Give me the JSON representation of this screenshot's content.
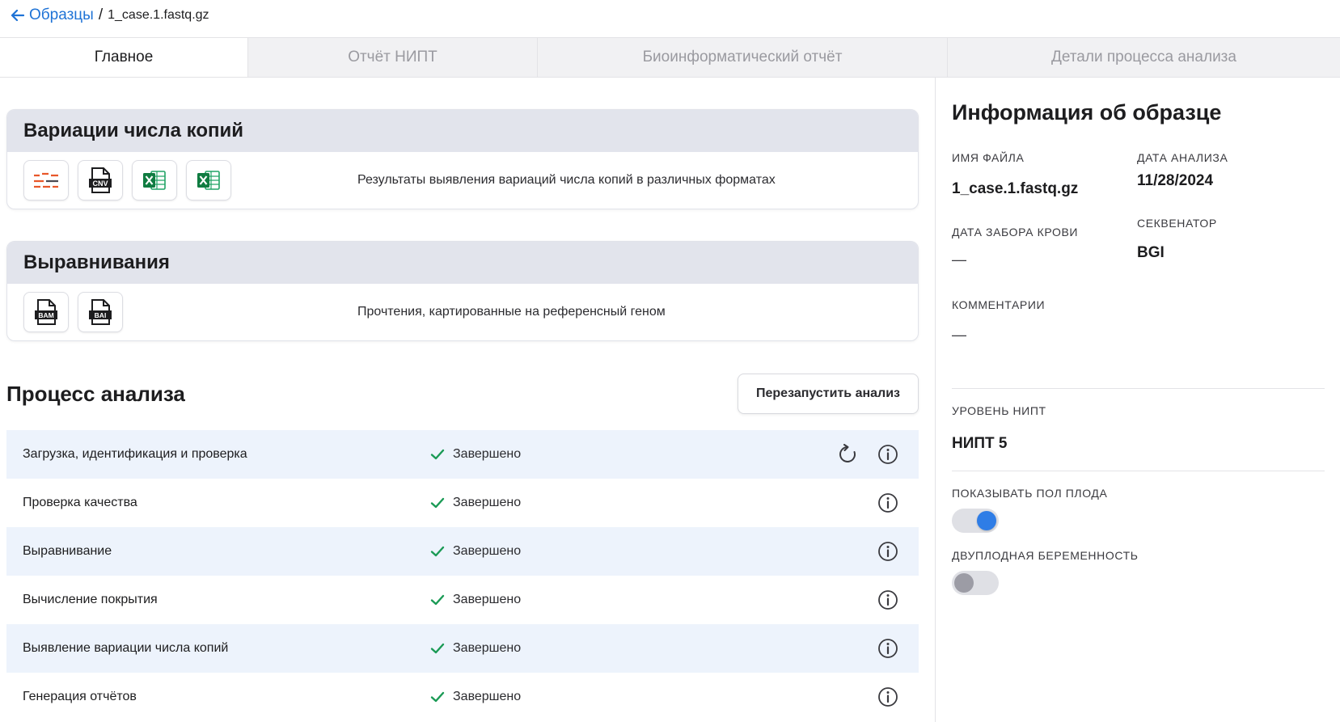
{
  "breadcrumb": {
    "back_label": "Образцы",
    "separator": "/",
    "current": "1_case.1.fastq.gz"
  },
  "tabs": [
    {
      "label": "Главное",
      "active": true
    },
    {
      "label": "Отчёт НИПТ",
      "active": false
    },
    {
      "label": "Биоинформатический отчёт",
      "active": false
    },
    {
      "label": "Детали процесса анализа",
      "active": false
    }
  ],
  "cnv_card": {
    "title": "Вариации числа копий",
    "description": "Результаты выявления вариаций числа копий в различных форматах",
    "icons": [
      "cnv-plot-icon",
      "cnv-file-icon",
      "excel-icon",
      "excel-icon"
    ]
  },
  "alignment_card": {
    "title": "Выравнивания",
    "description": "Прочтения, картированные на референсный геном",
    "icons": [
      {
        "name": "bam-file-icon",
        "text": "BAM"
      },
      {
        "name": "bai-file-icon",
        "text": "BAI"
      }
    ]
  },
  "cnv_icon_text": "CNV",
  "process": {
    "title": "Процесс анализа",
    "restart_label": "Перезапустить анализ",
    "steps": [
      {
        "name": "Загрузка, идентификация и проверка",
        "status": "Завершено",
        "restart": true
      },
      {
        "name": "Проверка качества",
        "status": "Завершено",
        "restart": false
      },
      {
        "name": "Выравнивание",
        "status": "Завершено",
        "restart": false
      },
      {
        "name": "Вычисление покрытия",
        "status": "Завершено",
        "restart": false
      },
      {
        "name": "Выявление вариации числа копий",
        "status": "Завершено",
        "restart": false
      },
      {
        "name": "Генерация отчётов",
        "status": "Завершено",
        "restart": false
      }
    ]
  },
  "sample_info": {
    "title": "Информация об образце",
    "file_name_label": "ИМЯ ФАЙЛА",
    "file_name": "1_case.1.fastq.gz",
    "analysis_date_label": "ДАТА АНАЛИЗА",
    "analysis_date": "11/28/2024",
    "blood_date_label": "ДАТА ЗАБОРА КРОВИ",
    "blood_date": "—",
    "sequencer_label": "СЕКВЕНАТОР",
    "sequencer": "BGI",
    "comments_label": "КОММЕНТАРИИ",
    "comments": "—",
    "nipt_level_label": "УРОВЕНЬ НИПТ",
    "nipt_level": "НИПТ 5",
    "show_sex_label": "ПОКАЗЫВАТЬ ПОЛ ПЛОДА",
    "show_sex_on": true,
    "twin_label": "ДВУПЛОДНАЯ БЕРЕМЕННОСТЬ",
    "twin_on": false
  },
  "colors": {
    "accent": "#2f7de6",
    "link": "#1f73d6",
    "success": "#1a9a55",
    "card_header": "#e2e4ec",
    "row_stripe": "#edf3fc"
  }
}
